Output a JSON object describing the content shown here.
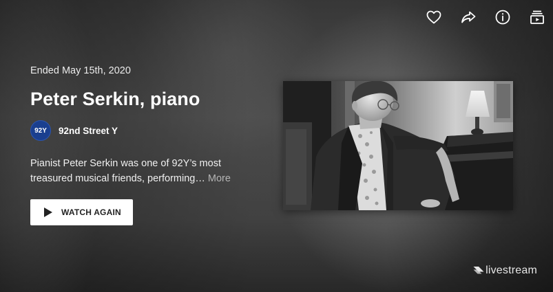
{
  "event": {
    "status": "Ended May 15th, 2020",
    "title": "Peter Serkin, piano",
    "description": "Pianist Peter Serkin was one of 92Y’s most treasured musical friends, performing…",
    "more_label": "More"
  },
  "organization": {
    "logo_text": "92Y",
    "name": "92nd Street Y"
  },
  "actions": {
    "watch_again_label": "WATCH AGAIN"
  },
  "top_icons": [
    "heart-icon",
    "share-icon",
    "info-icon",
    "playlist-icon"
  ],
  "brand": {
    "name": "livestream"
  },
  "colors": {
    "logo_blue": "#1a3f8f",
    "button_bg": "#ffffff",
    "more_text": "#b5b5b5"
  }
}
